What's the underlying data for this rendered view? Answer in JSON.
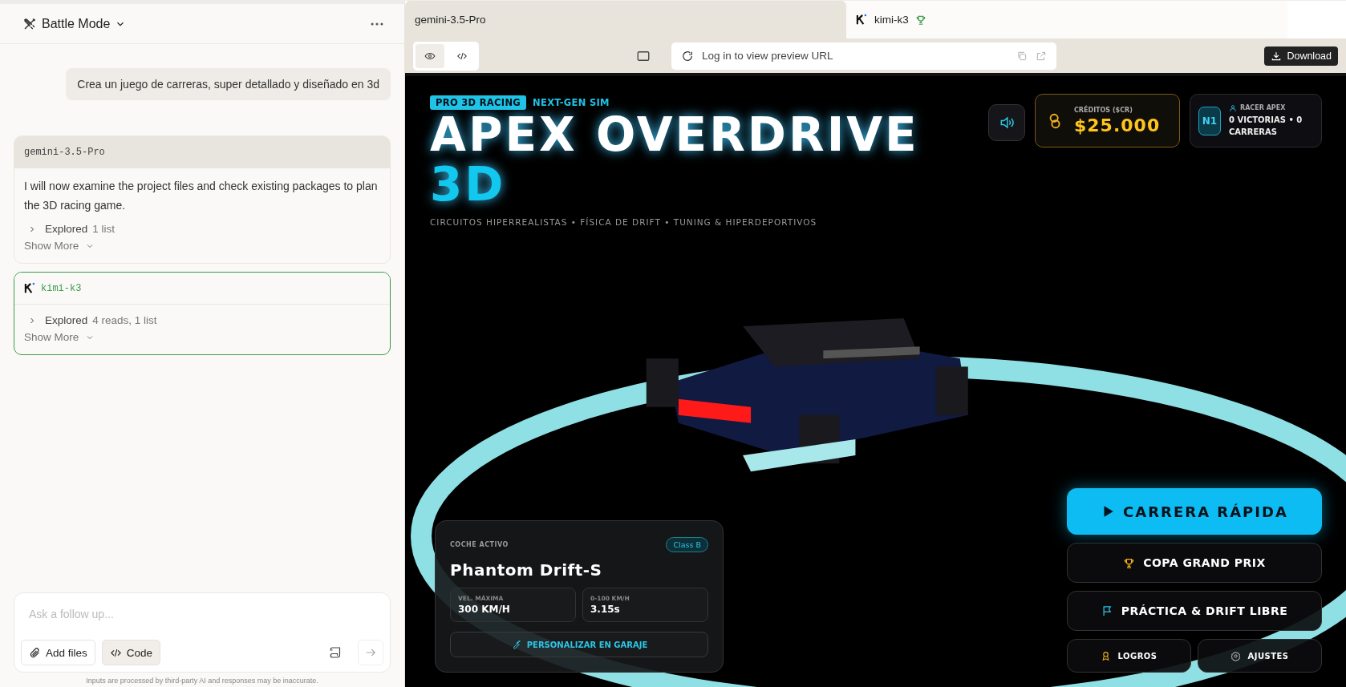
{
  "sidebar": {
    "title": "Battle Mode",
    "user_message": "Crea un juego de carreras, super detallado y diseñado en 3d",
    "responses": [
      {
        "model": "gemini-3.5-Pro",
        "logo": false,
        "winner": false,
        "text": "I will now examine the project files and check existing packages to plan the 3D racing game.",
        "explored_label": "Explored",
        "explored_detail": "1 list",
        "show_more": "Show More"
      },
      {
        "model": "kimi-k3",
        "logo": true,
        "winner": true,
        "explored_label": "Explored",
        "explored_detail": "4 reads, 1 list",
        "show_more": "Show More"
      }
    ],
    "input": {
      "placeholder": "Ask a follow up...",
      "buttons": [
        {
          "label": "Add files",
          "kind": "attach",
          "selected": false
        },
        {
          "label": "Code",
          "kind": "code",
          "selected": true
        }
      ]
    },
    "disclaimer": "Inputs are processed by third-party AI and responses may be inaccurate."
  },
  "tabs": [
    {
      "label": "gemini-3.5-Pro",
      "selected": true,
      "logo": false,
      "winner": false
    },
    {
      "label": "kimi-k3",
      "selected": false,
      "logo": true,
      "winner": true
    }
  ],
  "toolbar": {
    "view_modes": [
      {
        "kind": "preview",
        "selected": true
      },
      {
        "kind": "code",
        "selected": false
      }
    ],
    "url_placeholder": "Log in to view preview URL",
    "download": "Download"
  },
  "game": {
    "badges": [
      {
        "label": "PRO 3D RACING",
        "kind": "filled"
      },
      {
        "label": "NEXT-GEN SIM",
        "kind": "plain"
      }
    ],
    "title": "APEX OVERDRIVE",
    "title_accent": "3D",
    "subtitle": "CIRCUITOS HIPERREALISTAS • FÍSICA DE DRIFT • TUNING & HIPERDEPORTIVOS",
    "credits": {
      "label": "CRÉDITOS ($CR)",
      "value": "$25.000"
    },
    "racer": {
      "level": "N1",
      "label": "RACER APEX",
      "stats": "0 VICTORIAS • 0 CARRERAS"
    },
    "car": {
      "label": "COCHE ACTIVO",
      "class": "Class B",
      "name": "Phantom Drift-S",
      "stats": [
        {
          "label": "VEL. MÁXIMA",
          "value": "300 KM/H"
        },
        {
          "label": "0-100 KM/H",
          "value": "3.15s"
        }
      ],
      "garage": "PERSONALIZAR EN GARAJE"
    },
    "menu": [
      {
        "label": "CARRERA RÁPIDA",
        "kind": "primary"
      },
      {
        "label": "COPA GRAND PRIX",
        "kind": "secondary"
      },
      {
        "label": "PRÁCTICA & DRIFT LIBRE",
        "kind": "secondary"
      },
      {
        "label": "LOGROS",
        "kind": "small"
      },
      {
        "label": "AJUSTES",
        "kind": "small"
      }
    ]
  }
}
